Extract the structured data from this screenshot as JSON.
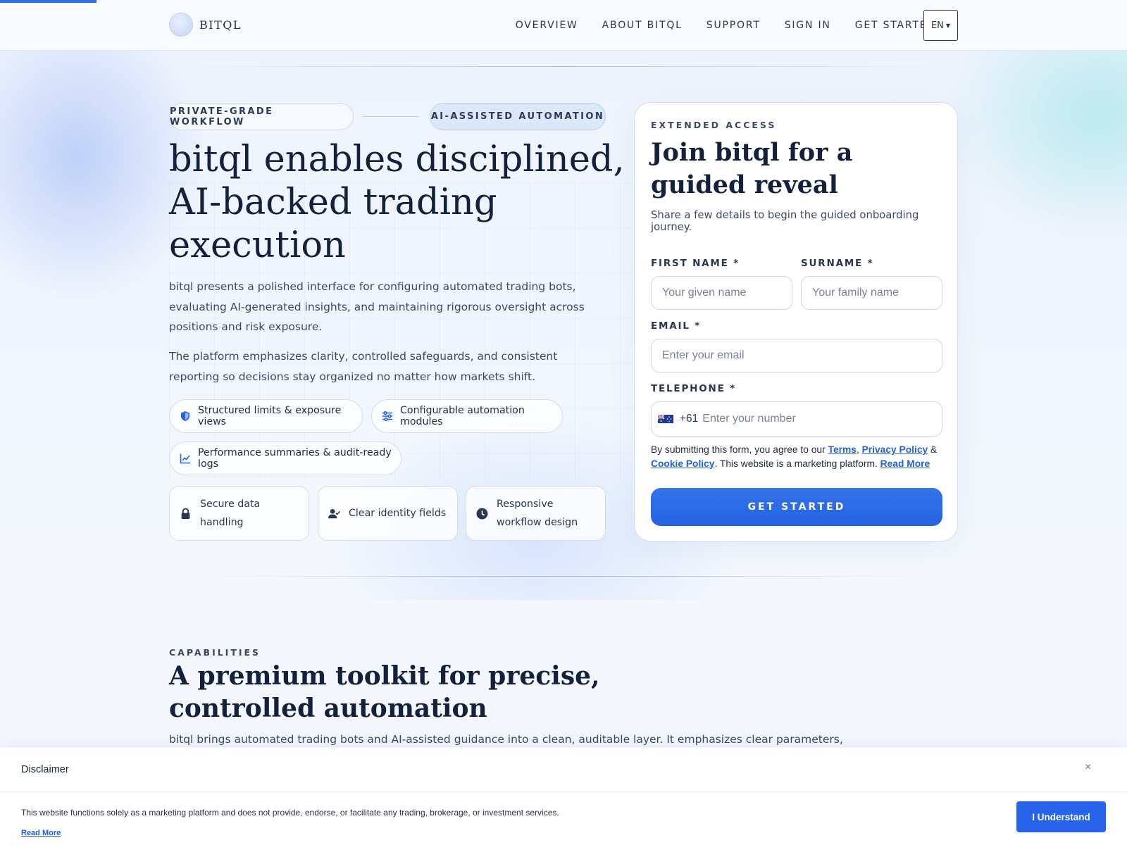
{
  "brand": {
    "name": "BITQL"
  },
  "nav": {
    "items": [
      "OVERVIEW",
      "ABOUT BITQL",
      "SUPPORT",
      "SIGN IN",
      "GET STARTED"
    ],
    "language": "EN"
  },
  "hero": {
    "pill_left": "PRIVATE-GRADE WORKFLOW",
    "pill_right": "AI-ASSISTED AUTOMATION",
    "title": "bitql enables disciplined, AI-backed trading execution",
    "paragraph_1": "bitql presents a polished interface for configuring automated trading bots, evaluating AI-generated insights, and maintaining rigorous oversight across positions and risk exposure.",
    "paragraph_2": "The platform emphasizes clarity, controlled safeguards, and consistent reporting so decisions stay organized no matter how markets shift.",
    "chips": [
      {
        "label": "Structured limits & exposure views",
        "icon": "shield-icon"
      },
      {
        "label": "Configurable automation modules",
        "icon": "sliders-icon"
      },
      {
        "label": "Performance summaries & audit-ready logs",
        "icon": "chart-line-icon"
      }
    ],
    "features": [
      {
        "label": "Secure data handling",
        "icon": "lock-icon"
      },
      {
        "label": "Clear identity fields",
        "icon": "user-check-icon"
      },
      {
        "label": "Responsive workflow design",
        "icon": "clock-icon"
      }
    ]
  },
  "form": {
    "kicker": "EXTENDED ACCESS",
    "title": "Join bitql for a guided reveal",
    "subtitle": "Share a few details to begin the guided onboarding journey.",
    "first_name_label": "FIRST NAME *",
    "first_name_placeholder": "Your given name",
    "surname_label": "SURNAME *",
    "surname_placeholder": "Your family name",
    "email_label": "EMAIL *",
    "email_placeholder": "Enter your email",
    "phone_label": "TELEPHONE *",
    "phone_dial_code": "+61",
    "phone_placeholder": "Enter your number",
    "legal_prefix": "By submitting this form, you agree to our",
    "terms_link": "Terms",
    "privacy_link": "Privacy Policy",
    "cookie_link": "Cookie Policy",
    "legal_suffix": ". This website is a marketing platform.",
    "read_more_link": "Read More",
    "submit_label": "GET STARTED"
  },
  "capabilities": {
    "kicker": "CAPABILITIES",
    "title": "A premium toolkit for precise, controlled automation",
    "paragraph": "bitql brings automated trading bots and AI-assisted guidance into a clean, auditable layer. It emphasizes clear parameters,"
  },
  "disclaimer": {
    "title": "Disclaimer",
    "text": "This website functions solely as a marketing platform and does not provide, endorse, or facilitate any trading, brokerage, or investment services.",
    "read_more": "Read More",
    "button_label": "I Understand",
    "close_symbol": "×"
  },
  "colors": {
    "accent": "#2f6ee8",
    "primary_button": "#2562e0",
    "heading": "#14213d",
    "link": "#2363d8"
  }
}
